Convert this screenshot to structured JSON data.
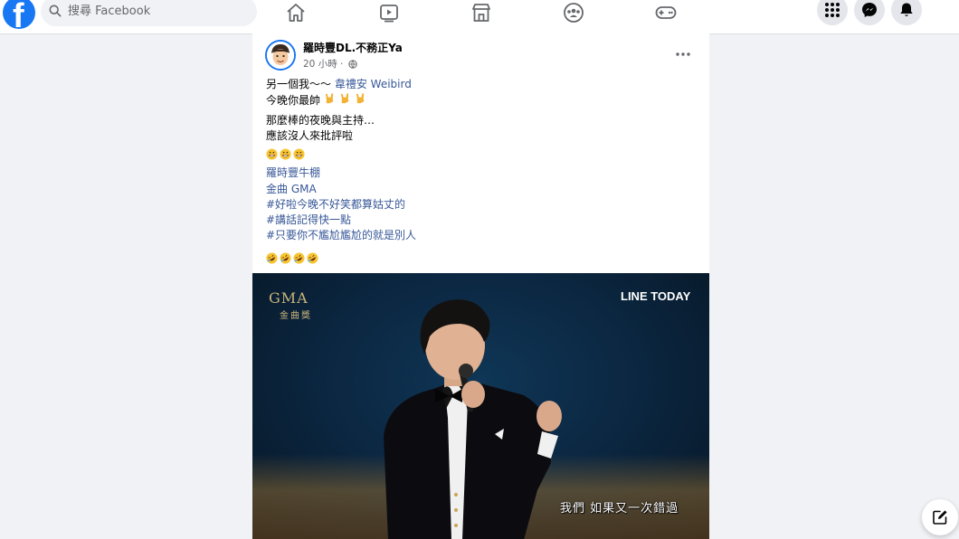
{
  "topbar": {
    "search_placeholder": "搜尋 Facebook",
    "logo_letter": "f"
  },
  "icons": {
    "nav": [
      "home-icon",
      "watch-icon",
      "marketplace-icon",
      "groups-icon",
      "gaming-icon"
    ],
    "right": [
      "menu-grid-icon",
      "messenger-icon",
      "notifications-icon"
    ]
  },
  "colors": {
    "brand": "#1877f2",
    "link": "#385898",
    "background": "#f0f2f5"
  },
  "post": {
    "author": "羅時豐DL.不務正Ya",
    "time": "20 小時 ·",
    "lines": {
      "l1_text": "另一個我～～",
      "l1_link": "韋禮安 Weibird",
      "l2_text": "今晚你最帥",
      "l3": "那麼棒的夜晚與主持…",
      "l4": "應該沒人來批評啦",
      "tag1": "羅時豐牛棚",
      "tag2": "金曲 GMA",
      "tag3": "#好啦今晚不好笑都算姑丈的",
      "tag4": "#講話記得快一點",
      "tag5": "#只要你不尷尬尷尬的就是別人"
    },
    "media": {
      "logo_top": "GMA",
      "logo_bottom": "金曲獎",
      "watermark": "LINE TODAY",
      "subtitle": "我們 如果又一次錯過"
    }
  }
}
